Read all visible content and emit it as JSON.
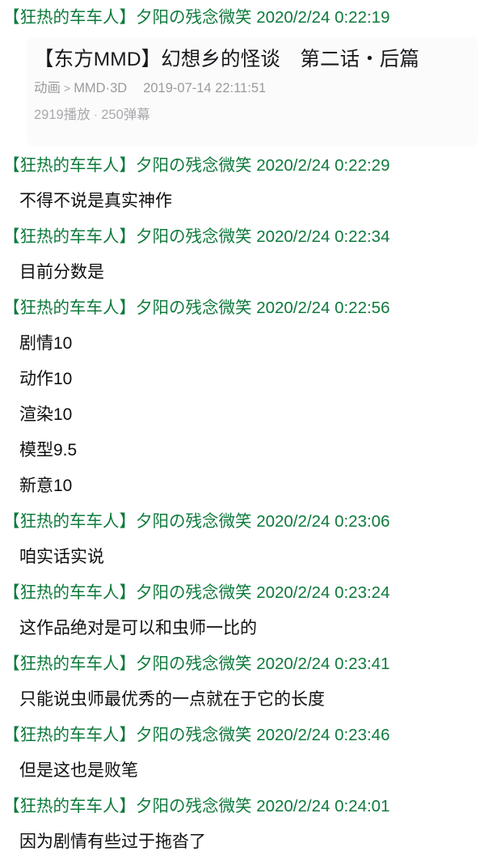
{
  "colors": {
    "sender_green": "#0f7a3c",
    "body_black": "#101010",
    "card_background": "#fbfbfb",
    "card_title": "#18191c",
    "card_meta_gray": "#9b9ba0",
    "page_background": "#ffffff"
  },
  "sender": {
    "name": "【狂热的车车人】夕阳の残念微笑",
    "nickname_bracketed": "【狂热的车车人】",
    "nickname_plain": "夕阳の残念微笑"
  },
  "video_card": {
    "title": "【东方MMD】幻想乡的怪谈　第二话・后篇",
    "category": "动画",
    "subcategory": "MMD·3D",
    "arrow": ">",
    "upload_date": "2019-07-14 22:11:51",
    "play_count": "2919播放",
    "separator": "·",
    "danmaku_count": "250弹幕"
  },
  "messages": [
    {
      "id": "m1",
      "timestamp": "2020/2/24 0:22:19",
      "header": "【狂热的车车人】夕阳の残念微笑 2020/2/24 0:22:19",
      "type": "video-card",
      "body": null
    },
    {
      "id": "m2",
      "timestamp": "2020/2/24 0:22:29",
      "header": "【狂热的车车人】夕阳の残念微笑 2020/2/24 0:22:29",
      "type": "text",
      "body": "不得不说是真实神作"
    },
    {
      "id": "m3",
      "timestamp": "2020/2/24 0:22:34",
      "header": "【狂热的车车人】夕阳の残念微笑 2020/2/24 0:22:34",
      "type": "text",
      "body": "目前分数是"
    },
    {
      "id": "m4",
      "timestamp": "2020/2/24 0:22:56",
      "header": "【狂热的车车人】夕阳の残念微笑 2020/2/24 0:22:56",
      "type": "multiline",
      "lines": [
        "剧情10",
        "动作10",
        "渲染10",
        "模型9.5",
        "新意10"
      ]
    },
    {
      "id": "m5",
      "timestamp": "2020/2/24 0:23:06",
      "header": "【狂热的车车人】夕阳の残念微笑 2020/2/24 0:23:06",
      "type": "text",
      "body": "咱实话实说"
    },
    {
      "id": "m6",
      "timestamp": "2020/2/24 0:23:24",
      "header": "【狂热的车车人】夕阳の残念微笑 2020/2/24 0:23:24",
      "type": "text",
      "body": "这作品绝对是可以和虫师一比的"
    },
    {
      "id": "m7",
      "timestamp": "2020/2/24 0:23:41",
      "header": "【狂热的车车人】夕阳の残念微笑 2020/2/24 0:23:41",
      "type": "text",
      "body": "只能说虫师最优秀的一点就在于它的长度"
    },
    {
      "id": "m8",
      "timestamp": "2020/2/24 0:23:46",
      "header": "【狂热的车车人】夕阳の残念微笑 2020/2/24 0:23:46",
      "type": "text",
      "body": "但是这也是败笔"
    },
    {
      "id": "m9",
      "timestamp": "2020/2/24 0:24:01",
      "header": "【狂热的车车人】夕阳の残念微笑 2020/2/24 0:24:01",
      "type": "text",
      "body": "因为剧情有些过于拖沓了"
    }
  ],
  "scores": {
    "剧情": "10",
    "动作": "10",
    "渲染": "10",
    "模型": "9.5",
    "新意": "10"
  }
}
